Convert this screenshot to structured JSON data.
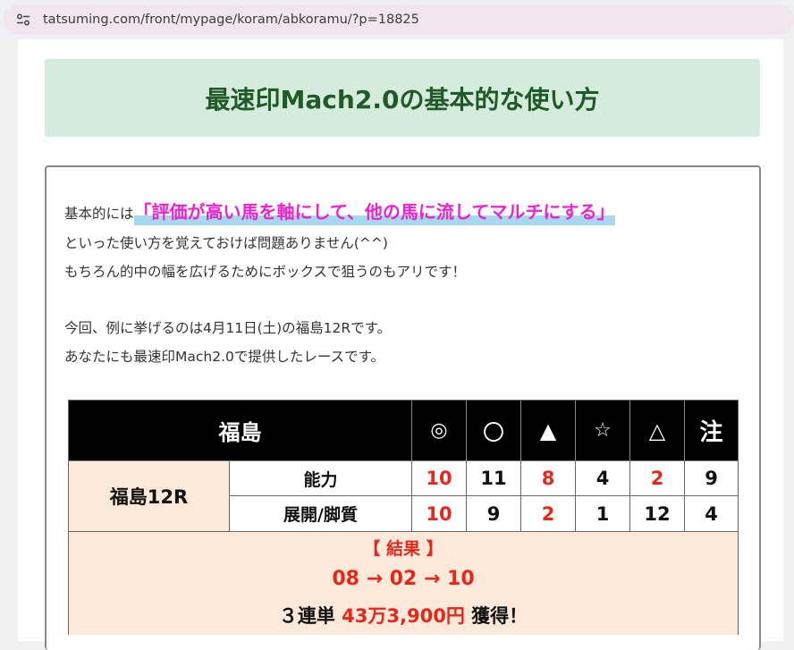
{
  "browser": {
    "url": "tatsuming.com/front/mypage/koram/abkoramu/?p=18825"
  },
  "article": {
    "title": "最速印Mach2.0の基本的な使い方",
    "p1_prefix": "基本的には",
    "p1_highlight": "「評価が高い馬を軸にして、他の馬に流してマルチにする」",
    "p2": "といった使い方を覚えておけば問題ありません(^^)",
    "p3": "もちろん的中の幅を広げるためにボックスで狙うのもアリです！",
    "p4": "今回、例に挙げるのは4月11日(土)の福島12Rです。",
    "p5": "あなたにも最速印Mach2.0で提供したレースです。"
  },
  "race_table": {
    "venue": "福島",
    "marks": [
      "◎",
      "〇",
      "▲",
      "☆",
      "△",
      "注"
    ],
    "race_name": "福島12R",
    "rows": [
      {
        "label": "能力",
        "values": [
          "10",
          "11",
          "8",
          "4",
          "2",
          "9"
        ]
      },
      {
        "label": "展開/脚質",
        "values": [
          "10",
          "9",
          "2",
          "1",
          "12",
          "4"
        ]
      }
    ],
    "result_header": "【 結果 】",
    "result_order": "08 → 02 → 10",
    "payout_prefix": "３連単 ",
    "payout_amount": "43万3,900円",
    "payout_suffix": " 獲得！"
  },
  "colors": {
    "title_bg": "#d5ecdc",
    "title_text": "#1f5a28",
    "highlight_text": "#ee22cc",
    "highlight_bar": "#a7d8ef",
    "result_bg": "#fde9d9",
    "red_number": "#e8261a"
  },
  "icons": {
    "site_info": "tune-icon"
  }
}
